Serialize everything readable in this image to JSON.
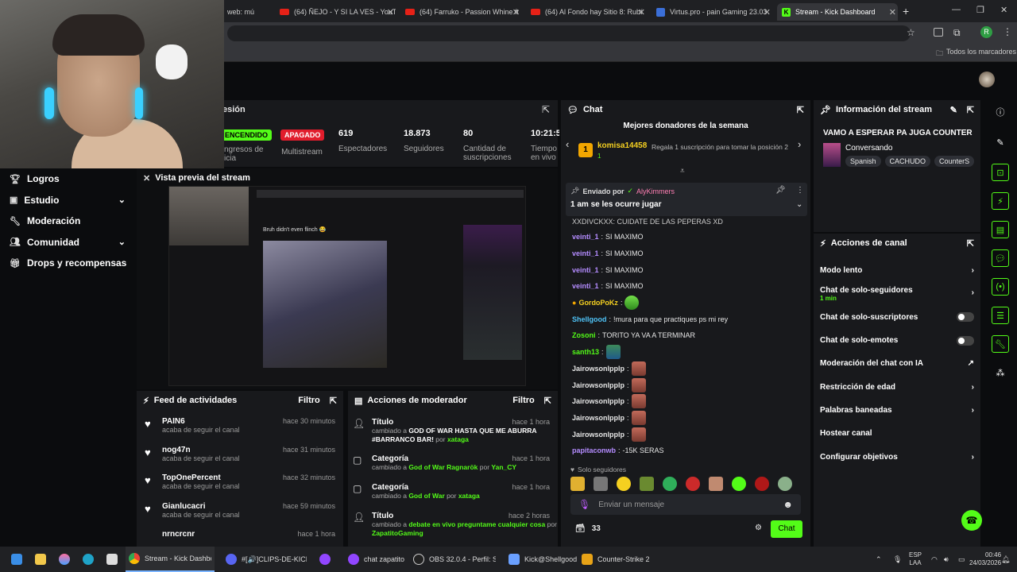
{
  "browser": {
    "tabs": [
      {
        "label": "web: mú",
        "kind": "none"
      },
      {
        "label": "(64) ÑEJO - Y SI LA VES - YouTu",
        "kind": "yt"
      },
      {
        "label": "(64) Farruko - Passion Whine ft",
        "kind": "yt"
      },
      {
        "label": "(64) Al Fondo hay Sitio 8: Rubí",
        "kind": "yt"
      },
      {
        "label": "Virtus.pro - pain Gaming 23.03",
        "kind": "vp"
      },
      {
        "label": "Stream - Kick Dashboard",
        "kind": "kick"
      }
    ],
    "new_tab": "+",
    "bookmarks_label": "Todos los marcadores"
  },
  "sidebar": {
    "items": [
      {
        "label": "Logros",
        "icon": "trophy-icon",
        "chev": ""
      },
      {
        "label": "Estudio",
        "icon": "studio-icon",
        "chev": "⌄"
      },
      {
        "label": "Moderación",
        "icon": "wrench-icon",
        "chev": ""
      },
      {
        "label": "Comunidad",
        "icon": "community-icon",
        "chev": "⌄"
      },
      {
        "label": "Drops y recompensas",
        "icon": "gift-icon",
        "chev": ""
      }
    ]
  },
  "session": {
    "title": "esión",
    "status_on": "ENCENDIDO",
    "status_off": "APAGADO",
    "stats": [
      {
        "value": "",
        "label": "ngresos de\nicia"
      },
      {
        "value": "",
        "label": "Multistream"
      },
      {
        "value": "619",
        "label": "Espectadores"
      },
      {
        "value": "18.873",
        "label": "Seguidores"
      },
      {
        "value": "80",
        "label": "Cantidad de\nsuscripciones"
      },
      {
        "value": "10:21:5",
        "label": "Tiempo\nen vivo"
      }
    ]
  },
  "preview": {
    "title": "Vista previa del stream",
    "caption": "Bruh didn't even flinch 😂"
  },
  "feed": {
    "title": "Feed de actividades",
    "filter": "Filtro",
    "items": [
      {
        "name": "PAIN6",
        "sub": "acaba de seguir el canal",
        "time": "hace 30 minutos"
      },
      {
        "name": "nog47n",
        "sub": "acaba de seguir el canal",
        "time": "hace 31 minutos"
      },
      {
        "name": "TopOnePercent",
        "sub": "acaba de seguir el canal",
        "time": "hace 32 minutos"
      },
      {
        "name": "Gianlucacri",
        "sub": "acaba de seguir el canal",
        "time": "hace 59 minutos"
      },
      {
        "name": "nrncrcnr",
        "sub": "",
        "time": "hace 1 hora"
      }
    ]
  },
  "modactions": {
    "title": "Acciones de moderador",
    "filter": "Filtro",
    "items": [
      {
        "type": "Título",
        "time": "hace 1 hora",
        "pre": "cambiado a ",
        "value": "GOD OF WAR HASTA QUE ME ABURRA #BARRANCO BAR!",
        "by": " por ",
        "user": "xataga"
      },
      {
        "type": "Categoría",
        "time": "hace 1 hora",
        "pre": "cambiado a ",
        "value": "God of War Ragnarök",
        "by": " por ",
        "user": "Yan_CY"
      },
      {
        "type": "Categoría",
        "time": "hace 1 hora",
        "pre": "cambiado a ",
        "value": "God of War",
        "by": " por ",
        "user": "xataga"
      },
      {
        "type": "Título",
        "time": "hace 2 horas",
        "pre": "cambiado a ",
        "value": "debate en vivo preguntame cualquier cosa",
        "by": " por ",
        "user": "ZapatitoGaming"
      }
    ]
  },
  "chat": {
    "title": "Chat",
    "donors_title": "Mejores donadores de la semana",
    "donor_rank": "1",
    "donor_name": "komisa14458",
    "donor_amount": "1",
    "donor_cta": "Regala 1 suscripción para tomar la posición 2",
    "pinned_by_label": "Enviado por",
    "pinned_user": "AlyKimmers",
    "pinned_text": "1 am se les ocurre jugar",
    "cut_line": "XXDIVCKXX: CUIDATE DE LAS PEPERAS XD",
    "messages": [
      {
        "user": "veinti_1",
        "color": "#b48cff",
        "text": "SI MAXIMO",
        "emotes": 0
      },
      {
        "user": "veinti_1",
        "color": "#b48cff",
        "text": "SI MAXIMO",
        "emotes": 0
      },
      {
        "user": "veinti_1",
        "color": "#b48cff",
        "text": "SI MAXIMO",
        "emotes": 0
      },
      {
        "user": "veinti_1",
        "color": "#b48cff",
        "text": "SI MAXIMO",
        "emotes": 0
      },
      {
        "user": "GordoPoKz",
        "color": "#f5d020",
        "text": "",
        "emotes": 1
      },
      {
        "user": "Shellgood",
        "color": "#4fc3f7",
        "text": "!mura para que practiques ps mi rey",
        "emotes": 0
      },
      {
        "user": "Zosoni",
        "color": "#53fc18",
        "text": "TORITO YA VA A TERMINAR",
        "emotes": 0
      },
      {
        "user": "santh13",
        "color": "#53fc18",
        "text": "",
        "emotes": 1
      },
      {
        "user": "Jairowsonlpplp",
        "color": "#d8d8d8",
        "text": "",
        "emotes": 1
      },
      {
        "user": "Jairowsonlpplp",
        "color": "#d8d8d8",
        "text": "",
        "emotes": 1
      },
      {
        "user": "Jairowsonlpplp",
        "color": "#d8d8d8",
        "text": "",
        "emotes": 1
      },
      {
        "user": "Jairowsonlpplp",
        "color": "#d8d8d8",
        "text": "",
        "emotes": 1
      },
      {
        "user": "Jairowsonlpplp",
        "color": "#d8d8d8",
        "text": "",
        "emotes": 1
      },
      {
        "user": "papitaconwb",
        "color": "#b48cff",
        "text": "-15K SERAS",
        "emotes": 0
      }
    ],
    "mode_label": "Solo seguidores",
    "input_placeholder": "Enviar un mensaje",
    "points": "33",
    "send_label": "Chat"
  },
  "streaminfo": {
    "title": "Información del stream",
    "stream_title": "VAMO A ESPERAR PA JUGA COUNTER",
    "category": "Conversando",
    "tags": [
      "Spanish",
      "CACHUDO",
      "CounterS"
    ]
  },
  "channel": {
    "title": "Acciones de canal",
    "actions": [
      {
        "label": "Modo lento",
        "sub": "",
        "kind": "chev"
      },
      {
        "label": "Chat de solo-seguidores",
        "sub": "1 min",
        "kind": "chev"
      },
      {
        "label": "Chat de solo-suscriptores",
        "sub": "",
        "kind": "toggle"
      },
      {
        "label": "Chat de solo-emotes",
        "sub": "",
        "kind": "toggle"
      },
      {
        "label": "Moderación del chat con IA",
        "sub": "",
        "kind": "ext"
      },
      {
        "label": "Restricción de edad",
        "sub": "",
        "kind": "chev"
      },
      {
        "label": "Palabras baneadas",
        "sub": "",
        "kind": "chev"
      },
      {
        "label": "Hostear canal",
        "sub": "",
        "kind": "none"
      },
      {
        "label": "Configurar objetivos",
        "sub": "",
        "kind": "chev"
      }
    ]
  },
  "taskbar": {
    "items": [
      {
        "label": "Stream - Kick Dashboan"
      },
      {
        "label": "#[🔊]CLIPS-DE-KICK🔊"
      },
      {
        "label": ""
      },
      {
        "label": "chat zapatito"
      },
      {
        "label": "OBS 32.0.4 - Perfil: Sin T"
      },
      {
        "label": "Kick@Shellgood"
      },
      {
        "label": "Counter-Strike 2"
      }
    ],
    "lang": "ESP",
    "lang2": "LAA",
    "time": "00:46",
    "date": "24/03/2026"
  },
  "colors": {
    "kick_green": "#53fc18",
    "panel": "#18191c",
    "bg": "#0b0c0e",
    "danger": "#e11d2c"
  }
}
